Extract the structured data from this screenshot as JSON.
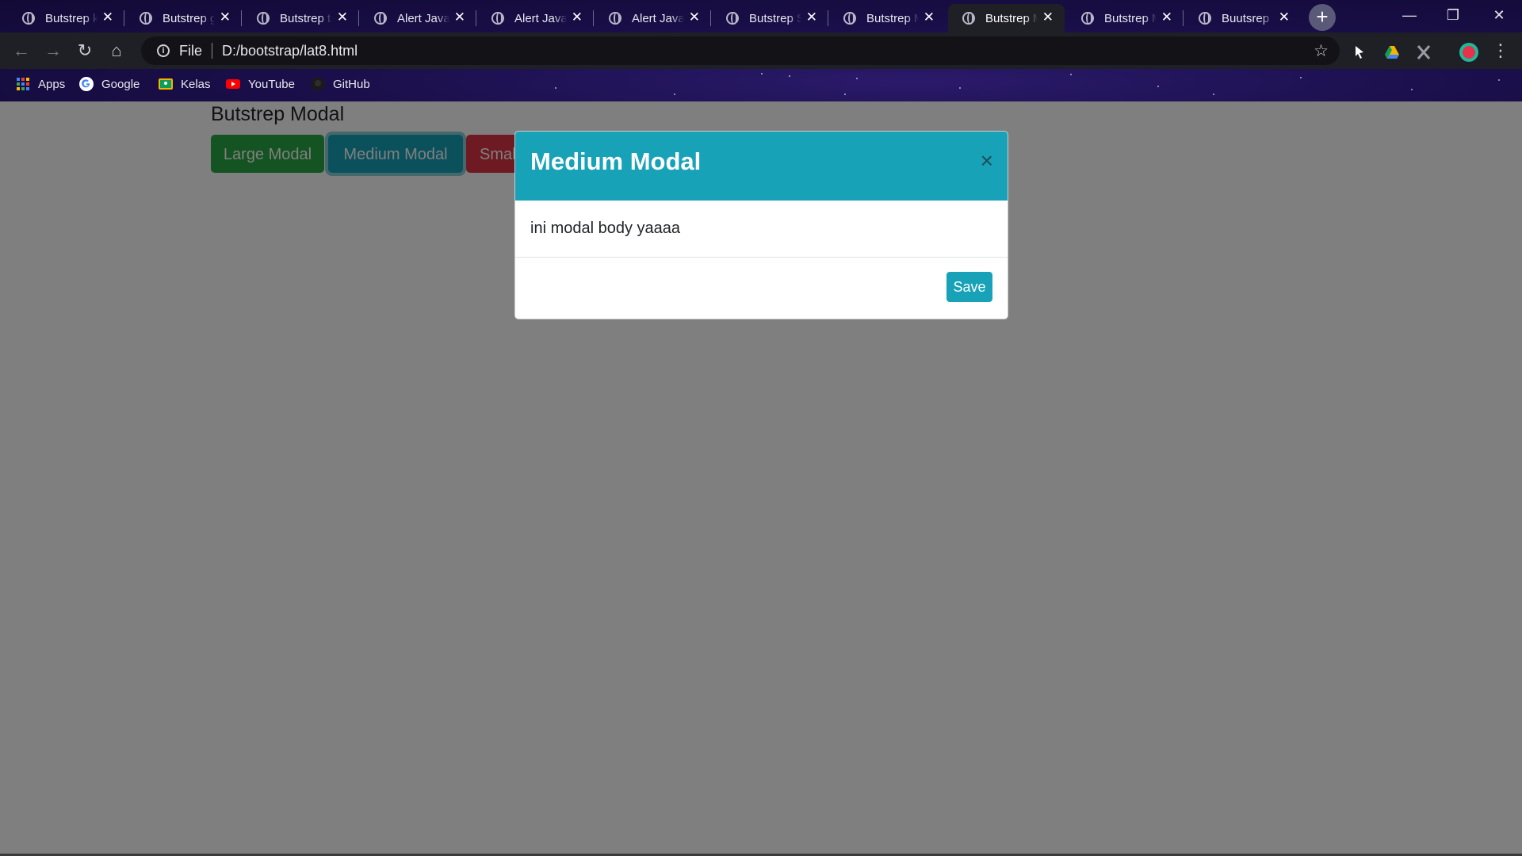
{
  "browser": {
    "tabs": [
      {
        "title": "Butstrep k",
        "active": false
      },
      {
        "title": "Butstrep g",
        "active": false
      },
      {
        "title": "Butstrep t",
        "active": false
      },
      {
        "title": "Alert Java",
        "active": false
      },
      {
        "title": "Alert Java",
        "active": false
      },
      {
        "title": "Alert Java",
        "active": false
      },
      {
        "title": "Butstrep S",
        "active": false
      },
      {
        "title": "Butstrep M",
        "active": false
      },
      {
        "title": "Butstrep M",
        "active": true
      },
      {
        "title": "Butstrep M",
        "active": false
      },
      {
        "title": "Buutsrep",
        "active": false
      }
    ],
    "new_tab_label": "+",
    "window_controls": {
      "minimize": "—",
      "maximize": "❐",
      "close": "✕"
    },
    "address": {
      "scheme_label": "File",
      "url": "D:/bootstrap/lat8.html"
    },
    "bookmarks": [
      {
        "label": "Apps",
        "icon": "apps-grid-icon"
      },
      {
        "label": "Google",
        "icon": "google-icon"
      },
      {
        "label": "Kelas",
        "icon": "classroom-icon"
      },
      {
        "label": "YouTube",
        "icon": "youtube-icon"
      },
      {
        "label": "GitHub",
        "icon": "github-icon"
      }
    ],
    "icons": {
      "back": "←",
      "forward": "→",
      "reload": "↻",
      "home": "⌂",
      "star": "☆",
      "tab_close": "✕",
      "menu": "⋮"
    }
  },
  "page": {
    "title": "Butstrep Modal",
    "buttons": {
      "large": "Large Modal",
      "medium": "Medium Modal",
      "small": "Small"
    }
  },
  "modal": {
    "title": "Medium Modal",
    "close_label": "×",
    "body": "ini modal body yaaaa",
    "save_label": "Save"
  },
  "colors": {
    "success": "#28a745",
    "info": "#17a2b8",
    "danger": "#dc3545",
    "chrome_bg": "#1a0f4a"
  }
}
